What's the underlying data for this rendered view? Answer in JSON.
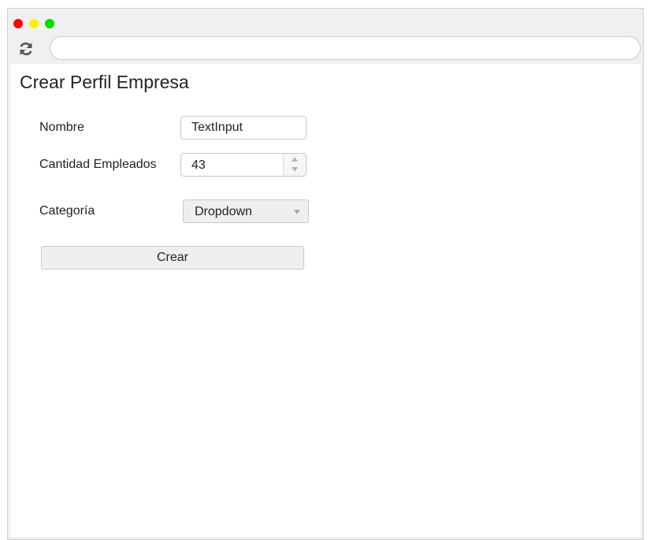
{
  "browser": {
    "url": "",
    "reload_icon": "reload-icon",
    "traffic_lights": {
      "close_color": "#ff0000",
      "minimize_color": "#ffee00",
      "maximize_color": "#00dd00"
    }
  },
  "page": {
    "title": "Crear Perfil Empresa"
  },
  "form": {
    "nombre": {
      "label": "Nombre",
      "value": "TextInput"
    },
    "empleados": {
      "label": "Cantidad Empleados",
      "value": "43"
    },
    "categoria": {
      "label": "Categoría",
      "selected": "Dropdown",
      "caret_icon": "chevron-down-icon"
    },
    "submit_label": "Crear"
  }
}
